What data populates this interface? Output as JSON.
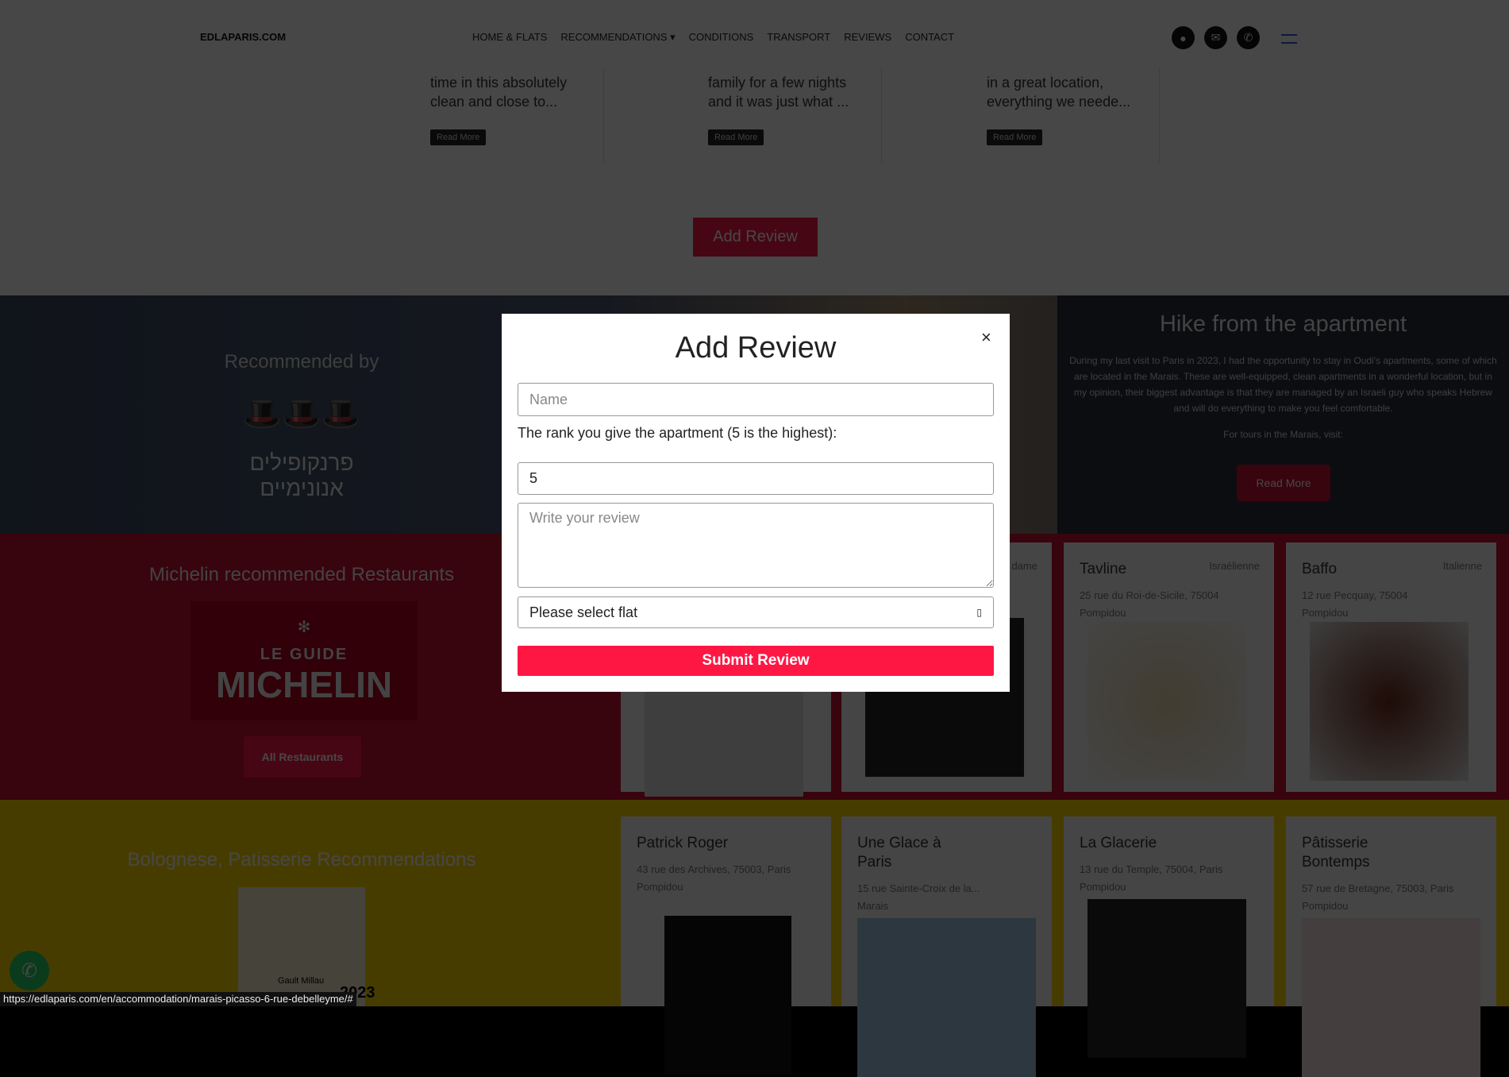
{
  "header": {
    "logo": "EDLAPARIS.COM",
    "nav": [
      "HOME & FLATS",
      "RECOMMENDATIONS",
      "CONDITIONS",
      "TRANSPORT",
      "REVIEWS",
      "CONTACT"
    ],
    "icons": [
      "user-icon",
      "mail-icon",
      "phone-icon"
    ]
  },
  "reviews": [
    {
      "line1": "time in this absolutely",
      "line2": "clean and close to...",
      "button": "Read More"
    },
    {
      "line1": "family for a few nights",
      "line2": "and it was just what ...",
      "button": "Read More"
    },
    {
      "line1": "in a great location,",
      "line2": "everything we neede...",
      "button": "Read More"
    }
  ],
  "add_review_button": "Add Review",
  "recommended": {
    "title": "Recommended by",
    "logo_text": "פרנקופילים אנונימיים"
  },
  "hike": {
    "title": "Hike from the apartment",
    "body": "During my last visit to Paris in 2023, I had the opportunity to stay in Oudi's apartments, some of which are located in the Marais. These are well-equipped, clean apartments in a wonderful location, but in my opinion, their biggest advantage is that they are managed by an Israeli guy who speaks Hebrew and will do everything to make you feel comfortable.",
    "tours": "For tours in the Marais, visit:",
    "button": "Read More"
  },
  "michelin": {
    "title": "Michelin recommended Restaurants",
    "logo_top": "LE GUIDE",
    "logo_main": "MICHELIN",
    "button": "All Restaurants"
  },
  "restaurants": [
    {
      "name": "",
      "cuisine": "",
      "address": "",
      "area": ""
    },
    {
      "name": "",
      "cuisine": "dame",
      "address": "",
      "area": ""
    },
    {
      "name": "Tavline",
      "cuisine": "Israélienne",
      "address": "25 rue du Roi-de-Sicile, 75004",
      "area": "Pompidou"
    },
    {
      "name": "Baffo",
      "cuisine": "Italienne",
      "address": "12 rue Pecquay, 75004",
      "area": "Pompidou"
    }
  ],
  "patisserie": {
    "title": "Bolognese, Patisserie Recommendations",
    "badge": "2023",
    "badge_brand": "Gault Millau"
  },
  "shops": [
    {
      "name": "Patrick Roger",
      "address": "43 rue des Archives, 75003, Paris",
      "area": "Pompidou"
    },
    {
      "name": "Une Glace à Paris",
      "address": "15 rue Sainte-Croix de la...",
      "area": "Marais"
    },
    {
      "name": "La Glacerie",
      "address": "13 rue du Temple, 75004, Paris",
      "area": "Pompidou"
    },
    {
      "name": "Pâtisserie Bontemps",
      "address": "57 rue de Bretagne, 75003, Paris",
      "area": "Pompidou"
    }
  ],
  "modal": {
    "title": "Add Review",
    "close": "×",
    "name_placeholder": "Name",
    "rank_label": "The rank you give the apartment (5 is the highest):",
    "rank_value": "5",
    "review_placeholder": "Write your review",
    "select_value": "Please select flat",
    "submit": "Submit Review"
  },
  "status_url": "https://edlaparis.com/en/accommodation/marais-picasso-6-rue-debelleyme/#",
  "colors": {
    "accent": "#ff1744",
    "michelin_bg": "#c8102e",
    "patisserie_bg": "#ffd800"
  }
}
